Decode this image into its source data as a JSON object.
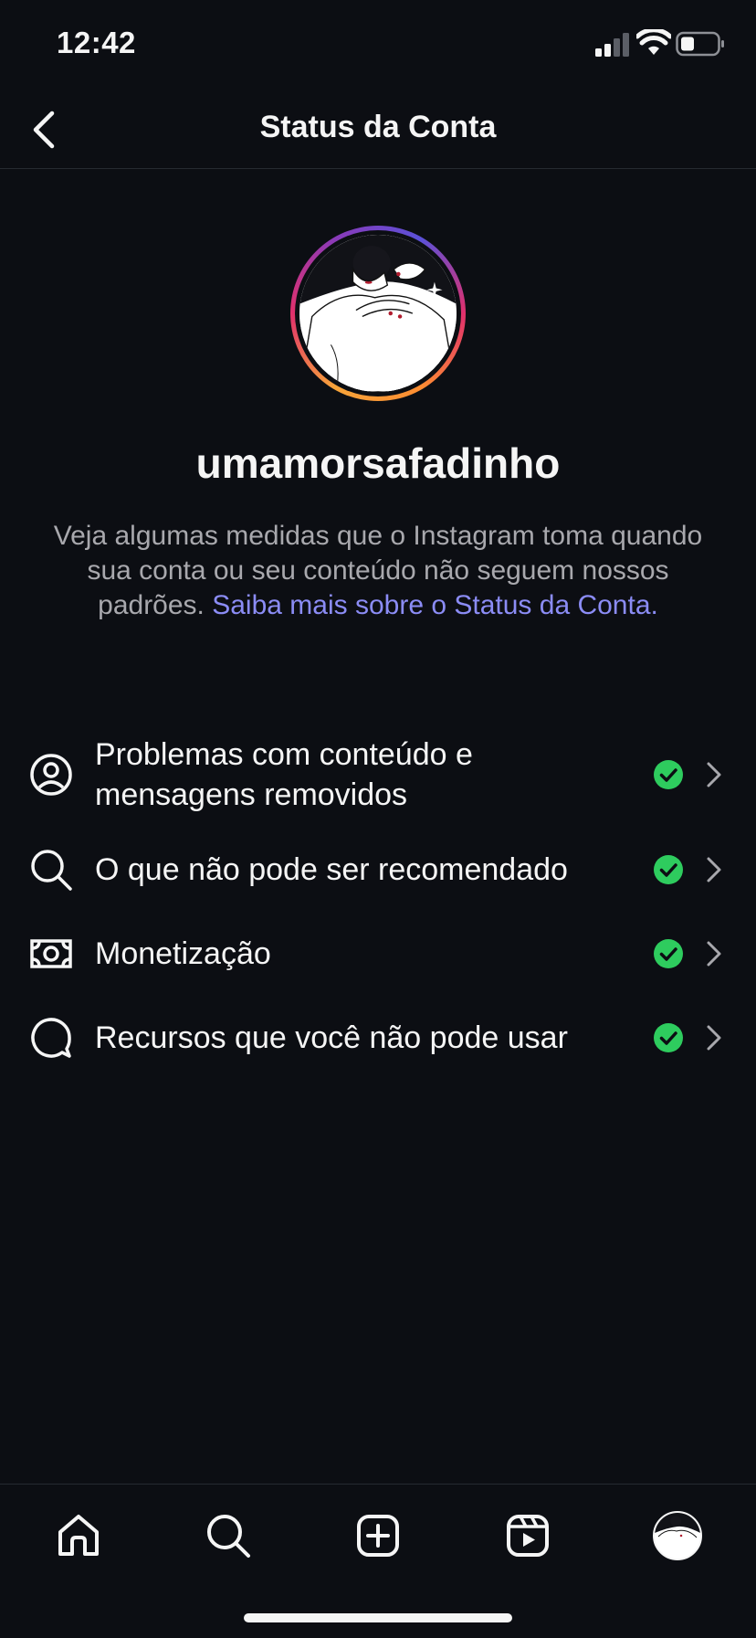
{
  "status_bar": {
    "time": "12:42"
  },
  "header": {
    "title": "Status da Conta",
    "back_icon": "chevron-left-icon"
  },
  "profile": {
    "username": "umamorsafadinho",
    "description": "Veja algumas medidas que o Instagram toma quando sua conta ou seu conteúdo não seguem nossos padrões.",
    "learn_more_link": "Saiba mais sobre o Status da Conta."
  },
  "status_items": [
    {
      "icon": "user-circle-icon",
      "label": "Problemas com conteúdo e mensagens removidos",
      "status": "ok"
    },
    {
      "icon": "search-icon",
      "label": "O que não pode ser recomendado",
      "status": "ok"
    },
    {
      "icon": "money-icon",
      "label": "Monetização",
      "status": "ok"
    },
    {
      "icon": "chat-bubble-icon",
      "label": "Recursos que você não pode usar",
      "status": "ok"
    }
  ],
  "tab_bar": {
    "tabs": [
      "home-icon",
      "search-icon",
      "create-icon",
      "reels-icon",
      "profile-avatar"
    ]
  },
  "colors": {
    "background": "#0c0e13",
    "link": "#8b8cf5",
    "check_green": "#2ecc5e",
    "muted_text": "#a8a8ad"
  }
}
